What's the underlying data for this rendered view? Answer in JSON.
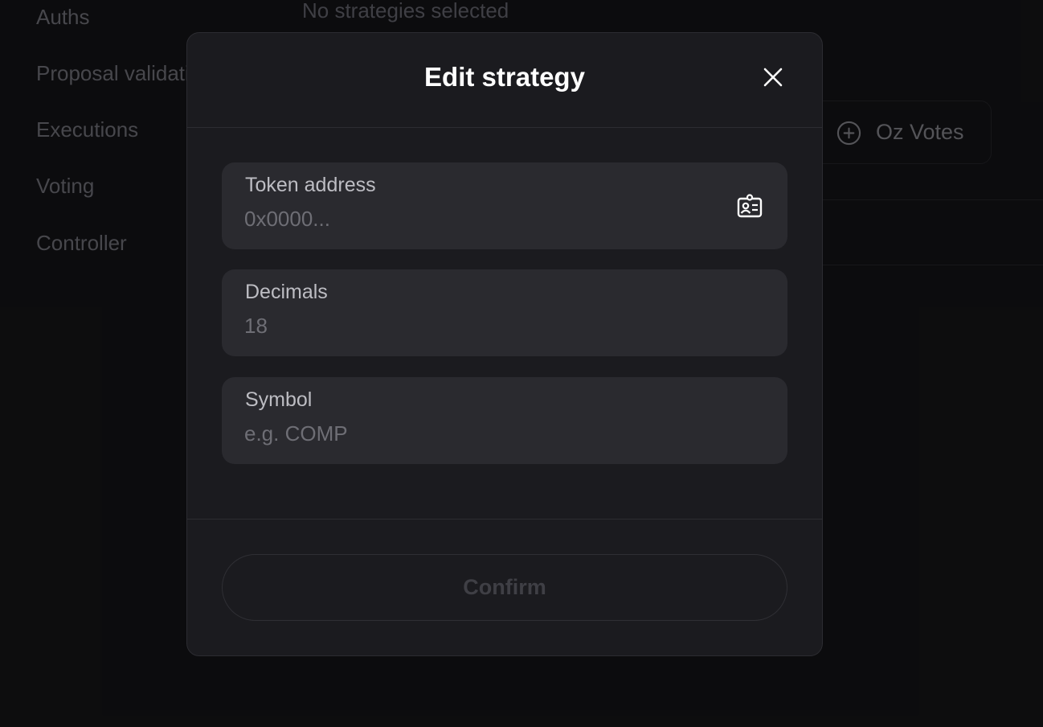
{
  "sidebar": {
    "items": [
      {
        "label": "Auths"
      },
      {
        "label": "Proposal validation"
      },
      {
        "label": "Executions"
      },
      {
        "label": "Voting"
      },
      {
        "label": "Controller"
      }
    ]
  },
  "main": {
    "empty_note": "No strategies selected",
    "strategy_option": {
      "label": "Oz Votes",
      "icon": "plus-circle-icon"
    }
  },
  "modal": {
    "title": "Edit strategy",
    "close_icon": "close-icon",
    "fields": {
      "token_address": {
        "label": "Token address",
        "value": "",
        "placeholder": "0x0000...",
        "icon": "contact-card-icon"
      },
      "decimals": {
        "label": "Decimals",
        "value": "",
        "placeholder": "18"
      },
      "symbol": {
        "label": "Symbol",
        "value": "",
        "placeholder": "e.g. COMP"
      }
    },
    "confirm_label": "Confirm"
  },
  "colors": {
    "background": "#111113",
    "modal_bg": "#1b1b1f",
    "field_bg": "#2a2a2f",
    "title": "#ffffff"
  }
}
